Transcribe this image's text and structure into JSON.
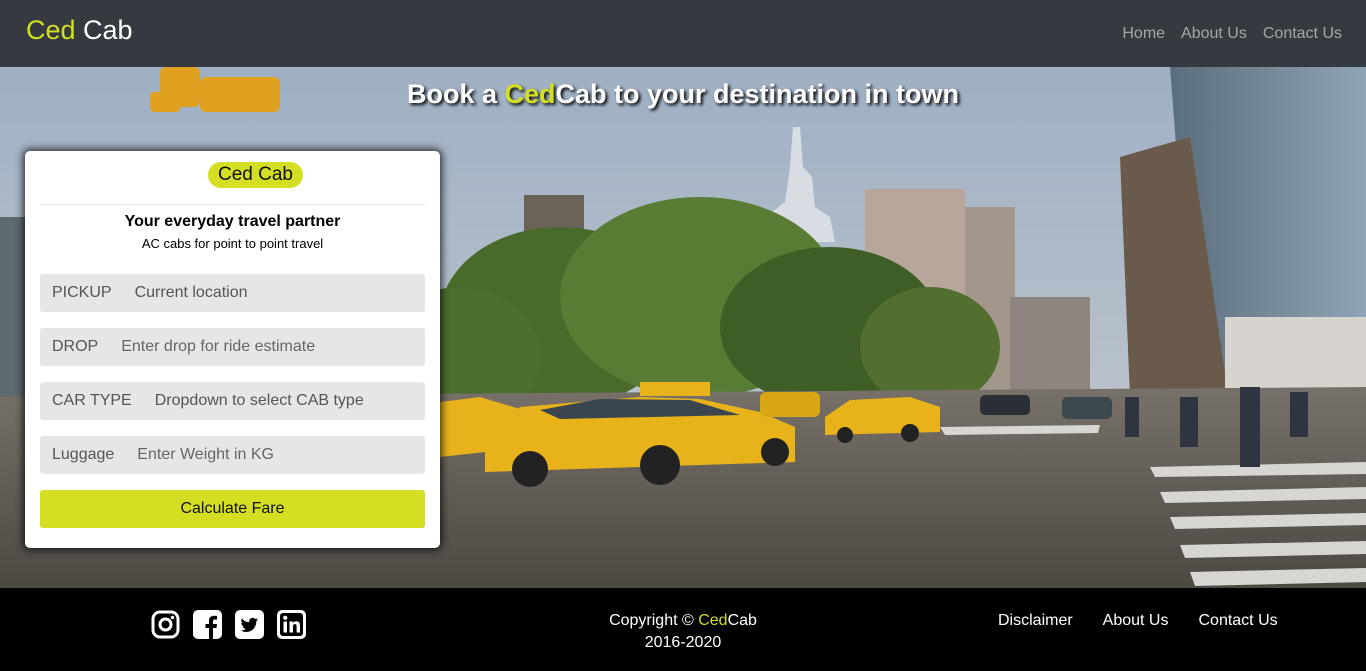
{
  "navbar": {
    "brand_accent": "Ced",
    "brand_rest": " Cab",
    "links": [
      "Home",
      "About Us",
      "Contact Us"
    ]
  },
  "hero": {
    "title_prefix": "Book a ",
    "title_accent": "Ced",
    "title_suffix": "Cab to your destination in town"
  },
  "card": {
    "badge": "Ced Cab",
    "heading": "Your everyday travel partner",
    "subheading": "AC cabs for point to point travel",
    "pickup": {
      "label": "PICKUP",
      "value": "Current location"
    },
    "drop": {
      "label": "DROP",
      "placeholder": "Enter drop for ride estimate"
    },
    "car_type": {
      "label": "CAR TYPE",
      "selected": "Dropdown to select CAB type"
    },
    "luggage": {
      "label": "Luggage",
      "placeholder": "Enter Weight in KG"
    },
    "button": "Calculate Fare"
  },
  "footer": {
    "social_icons": [
      "instagram-icon",
      "facebook-icon",
      "twitter-icon",
      "linkedin-icon"
    ],
    "copyright_prefix": "Copyright © ",
    "copyright_accent": "Ced",
    "copyright_suffix": "Cab",
    "years": "2016-2020",
    "links": [
      "Disclaimer",
      "About Us",
      "Contact Us"
    ]
  },
  "colors": {
    "accent": "#d4de22",
    "navbar": "#343a40",
    "footer": "#000000"
  }
}
